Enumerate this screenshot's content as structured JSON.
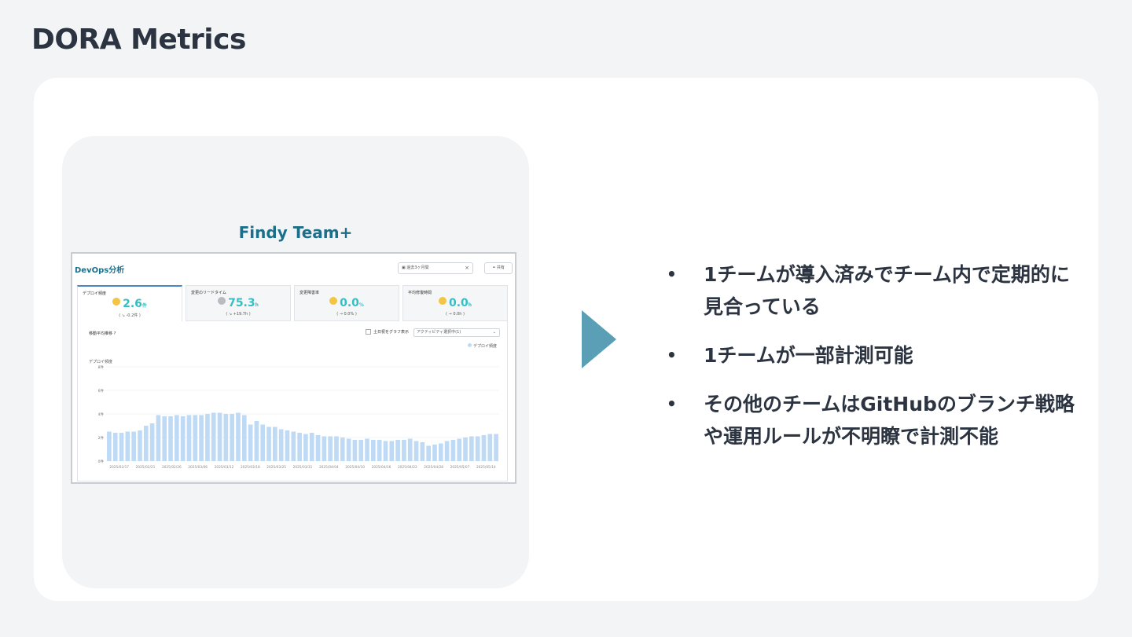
{
  "slide": {
    "title": "DORA Metrics"
  },
  "left_panel": {
    "product_name": "Findy Team+",
    "screenshot": {
      "page_title": "DevOps分析",
      "date_range": "過去3ヶ月間",
      "share_label": "共有",
      "tabs": [
        {
          "label": "デプロイ頻度",
          "value": "2.6",
          "unit": "件",
          "delta": "( ↘ -0.2件 )",
          "medal": "gold"
        },
        {
          "label": "変更のリードタイム",
          "value": "75.3",
          "unit": "h",
          "delta": "( ↘ +19.7h )",
          "medal": "grey"
        },
        {
          "label": "変更障害率",
          "value": "0.0",
          "unit": "%",
          "delta": "( → 0.0% )",
          "medal": "gold"
        },
        {
          "label": "平均修復時間",
          "value": "0.0",
          "unit": "h",
          "delta": "( → 0.0h )",
          "medal": "gold"
        }
      ],
      "chart_label": "移動平均推移",
      "weekend_toggle_label": "土日祝をグラフ表示",
      "activity_select": "アクティビティ選択中(1)",
      "legend": "デプロイ頻度",
      "y_title": "デプロイ頻度"
    }
  },
  "bullets": [
    "1チームが導入済みでチーム内で定期的に見合っている",
    "1チームが一部計測可能",
    "その他のチームはGitHubのブランチ戦略や運用ルールが不明瞭で計測不能"
  ],
  "colors": {
    "accent": "#1d6e8a",
    "arrow": "#5a9fb6",
    "bar": "#bfdaf5",
    "value": "#34bfc6"
  },
  "chart_data": {
    "type": "bar",
    "ylim": [
      0,
      8
    ],
    "y_ticks": [
      "8件",
      "6件",
      "4件",
      "2件",
      "0件"
    ],
    "x_tick_labels": [
      "2025/02/17",
      "2025/02/21",
      "2025/02/26",
      "2025/03/06",
      "2025/03/12",
      "2025/03/18",
      "2025/03/25",
      "2025/03/31",
      "2025/04/04",
      "2025/04/10",
      "2025/04/16",
      "2025/04/22",
      "2025/04/28",
      "2025/05/07",
      "2025/05/14"
    ],
    "series": [
      {
        "name": "デプロイ頻度",
        "values": [
          2.5,
          2.4,
          2.4,
          2.5,
          2.5,
          2.6,
          3.0,
          3.2,
          3.9,
          3.8,
          3.8,
          3.9,
          3.8,
          3.9,
          3.9,
          3.9,
          4.0,
          4.1,
          4.1,
          4.0,
          4.0,
          4.1,
          3.9,
          3.1,
          3.4,
          3.1,
          2.9,
          2.9,
          2.7,
          2.6,
          2.5,
          2.4,
          2.3,
          2.4,
          2.2,
          2.1,
          2.1,
          2.1,
          2.0,
          1.9,
          1.8,
          1.8,
          1.9,
          1.8,
          1.8,
          1.7,
          1.7,
          1.8,
          1.8,
          1.9,
          1.7,
          1.6,
          1.3,
          1.4,
          1.5,
          1.7,
          1.8,
          1.9,
          2.0,
          2.1,
          2.1,
          2.2,
          2.3,
          2.3
        ]
      }
    ]
  }
}
